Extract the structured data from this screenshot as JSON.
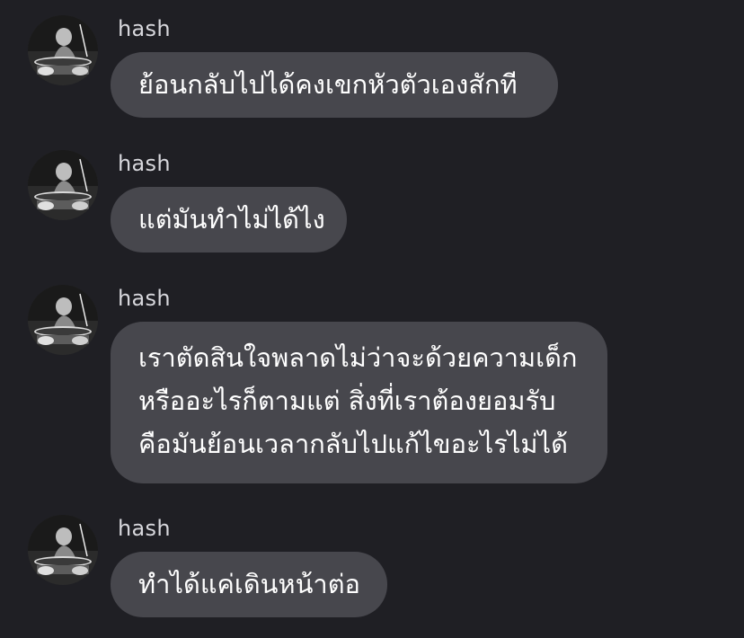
{
  "messages": [
    {
      "sender": "hash",
      "lines": [
        "ย้อนกลับไปได้คงเขกหัวตัวเองสักที"
      ]
    },
    {
      "sender": "hash",
      "lines": [
        "แต่มันทำไม่ได้ไง"
      ]
    },
    {
      "sender": "hash",
      "lines": [
        "เราตัดสินใจพลาดไม่ว่าจะด้วยความเด็ก",
        "หรืออะไรก็ตามแต่ สิ่งที่เราต้องยอมรับ",
        "คือมันย้อนเวลากลับไปแก้ไขอะไรไม่ได้"
      ]
    },
    {
      "sender": "hash",
      "lines": [
        "ทำได้แค่เดินหน้าต่อ"
      ]
    }
  ],
  "colors": {
    "background": "#1f1f24",
    "bubble": "#47474d",
    "text": "#ffffff",
    "sender": "#d7d7dc"
  },
  "icons": {
    "avatar": "user-avatar-photo-drummer"
  }
}
